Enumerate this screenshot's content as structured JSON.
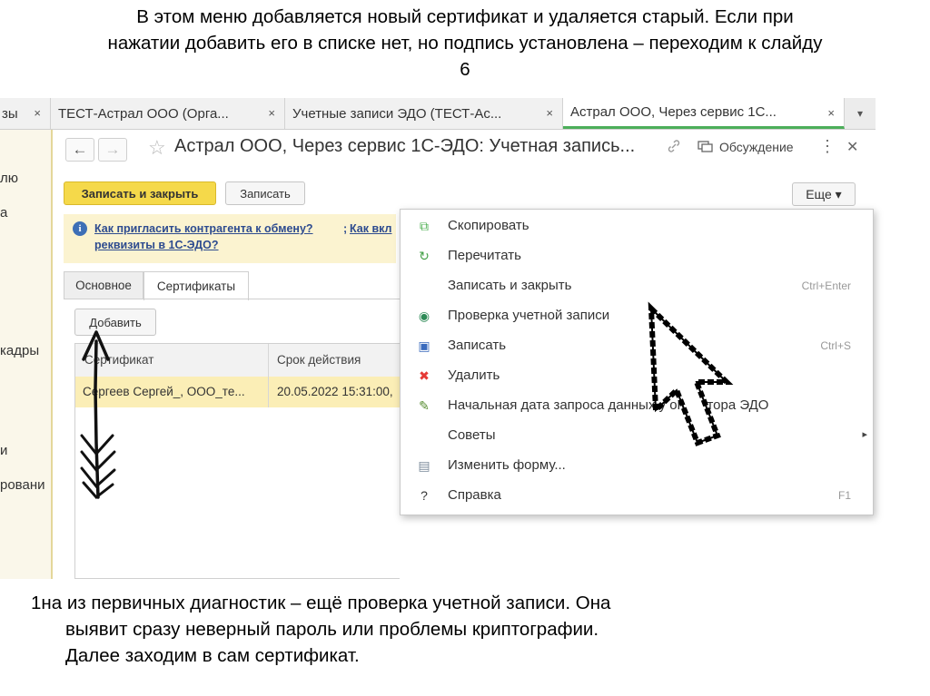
{
  "slide": {
    "title_lines": [
      "В этом меню добавляется новый сертификат и удаляется старый. Если при",
      "нажатии добавить его в списке нет, но подпись установлена – переходим к слайду",
      "6"
    ],
    "caption_lines": [
      "1на из первичных диагностик – ещё проверка учетной записи. Она",
      "выявит сразу неверный пароль или проблемы криптографии.",
      "Далее заходим в сам сертификат."
    ]
  },
  "left_panel": {
    "items": [
      "лю",
      "а",
      "кадры",
      "и",
      "ровани"
    ]
  },
  "tabs": [
    {
      "label": "зы",
      "close": "×"
    },
    {
      "label": "ТЕСТ-Астрал ООО (Орга...",
      "close": "×"
    },
    {
      "label": "Учетные записи ЭДО (ТЕСТ-Ас...",
      "close": "×"
    },
    {
      "label": "Астрал ООО, Через сервис 1С...",
      "close": "×",
      "active": true
    }
  ],
  "tab_menu_icon": "▾",
  "header": {
    "back_icon": "←",
    "forward_icon": "→",
    "star_icon": "☆",
    "title": "Астрал ООО, Через сервис 1С-ЭДО: Учетная запись...",
    "link_icon": "🔗",
    "discuss_icon": "▢",
    "discuss_label": "Обсуждение",
    "more_icon": "⋮",
    "close_icon": "✕"
  },
  "toolbar": {
    "save_close": "Записать и закрыть",
    "save": "Записать",
    "more": "Еще ▾"
  },
  "info": {
    "icon": "i",
    "link1": "Как пригласить контрагента к обмену?",
    "link2": "Как вкл",
    "link3": "реквизиты в 1С-ЭДО?",
    "sep": ";"
  },
  "form_tabs": [
    "Основное",
    "Сертификаты"
  ],
  "add_button": "Добавить",
  "table": {
    "columns": [
      "Сертификат",
      "Срок действия"
    ],
    "rows": [
      [
        "Сергеев Сергей_, ООО_те...",
        "20.05.2022 15:31:00,"
      ]
    ]
  },
  "menu": {
    "items": [
      {
        "label": "Скопировать",
        "icon": "copy-icon",
        "glyph": "⧉",
        "color": "#4caf50",
        "shortcut": ""
      },
      {
        "label": "Перечитать",
        "icon": "refresh-icon",
        "glyph": "↻",
        "color": "#43a047",
        "shortcut": ""
      },
      {
        "label": "Записать и закрыть",
        "icon": "",
        "glyph": "",
        "color": "",
        "shortcut": "Ctrl+Enter"
      },
      {
        "label": "Проверка учетной записи",
        "icon": "globe-check-icon",
        "glyph": "◉",
        "color": "#2e8b57",
        "shortcut": ""
      },
      {
        "label": "Записать",
        "icon": "save-icon",
        "glyph": "▣",
        "color": "#3a6bbd",
        "shortcut": "Ctrl+S"
      },
      {
        "label": "Удалить",
        "icon": "delete-icon",
        "glyph": "✖",
        "color": "#e53935",
        "shortcut": ""
      },
      {
        "label": "Начальная дата запроса данных у оператора ЭДО",
        "icon": "pencil-icon",
        "glyph": "✎",
        "color": "#558b2f",
        "shortcut": ""
      },
      {
        "label": "Советы",
        "icon": "",
        "glyph": "",
        "color": "",
        "shortcut": "",
        "submenu": "▸"
      },
      {
        "label": "Изменить форму...",
        "icon": "form-icon",
        "glyph": "▤",
        "color": "#7a8a9a",
        "shortcut": ""
      },
      {
        "label": "Справка",
        "icon": "help-icon",
        "glyph": "?",
        "color": "#333333",
        "shortcut": "F1"
      }
    ]
  },
  "colors": {
    "accent_yellow": "#f5d94a",
    "row_highlight": "#fbeeb6",
    "active_tab_underline": "#4cae5a"
  }
}
